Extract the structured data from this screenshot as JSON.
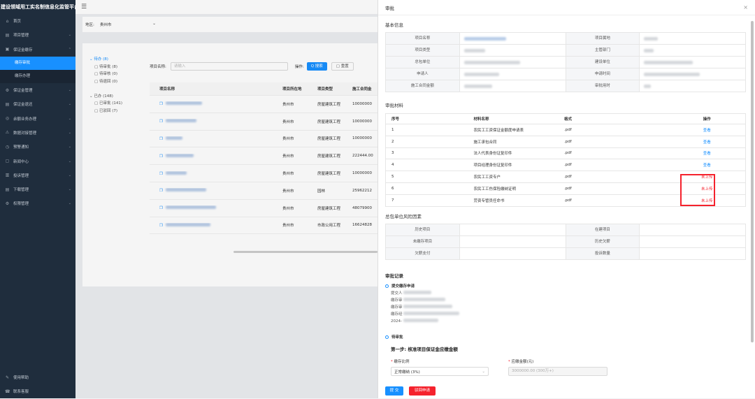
{
  "app": {
    "title": "建设领域用工实名制信息化监管平台"
  },
  "sidebar": {
    "items": [
      {
        "icon": "home-icon",
        "glyph": "⌂",
        "label": "首页",
        "chev": ""
      },
      {
        "icon": "project-icon",
        "glyph": "▤",
        "label": "项目管理",
        "chev": "⌄"
      },
      {
        "icon": "deposit-icon",
        "glyph": "▣",
        "label": "保证金缴存",
        "chev": "⌃"
      }
    ],
    "sub": [
      {
        "label": "缴存审批",
        "active": true
      },
      {
        "label": "缴存办理",
        "active": false
      }
    ],
    "items2": [
      {
        "icon": "manage-icon",
        "glyph": "⚙",
        "label": "保证金管理",
        "chev": "⌄"
      },
      {
        "icon": "return-icon",
        "glyph": "▤",
        "label": "保证金退还",
        "chev": "⌄"
      },
      {
        "icon": "dispute-icon",
        "glyph": "◎",
        "label": "余额业务办理",
        "chev": "⌄"
      },
      {
        "icon": "data-icon",
        "glyph": "⚠",
        "label": "数据对接管理",
        "chev": "⌄"
      },
      {
        "icon": "warning-icon",
        "glyph": "◷",
        "label": "预警通知",
        "chev": "⌄"
      },
      {
        "icon": "news-icon",
        "glyph": "▢",
        "label": "新闻中心",
        "chev": "⌄"
      },
      {
        "icon": "complaint-icon",
        "glyph": "▥",
        "label": "投诉管理",
        "chev": "⌄"
      },
      {
        "icon": "download-icon",
        "glyph": "▤",
        "label": "下载管理",
        "chev": "⌄"
      },
      {
        "icon": "auth-icon",
        "glyph": "⚙",
        "label": "权限管理",
        "chev": "⌄"
      }
    ],
    "bottom": [
      {
        "icon": "help-icon",
        "glyph": "✎",
        "label": "使用帮助"
      },
      {
        "icon": "service-icon",
        "glyph": "☎",
        "label": "联系客服"
      }
    ]
  },
  "topbar": {
    "menu_icon": "☰"
  },
  "region": {
    "label": "地区:",
    "value": "贵州市",
    "chev": "⌄"
  },
  "tree": [
    {
      "text": "⌄ 待办 (8)",
      "highlight": true
    },
    {
      "text": "▢ 待审批 (8)",
      "indent": true
    },
    {
      "text": "▢ 待审核 (0)",
      "indent": true
    },
    {
      "text": "▢ 待退回 (0)",
      "indent": true
    },
    {
      "text": "",
      "spacer": true
    },
    {
      "text": "⌄ 已办 (148)",
      "highlight": false
    },
    {
      "text": "▢ 已审批 (141)",
      "indent": true
    },
    {
      "text": "▢ 已驳回 (7)",
      "indent": true
    }
  ],
  "filter": {
    "name_label": "项目名称:",
    "name_placeholder": "请输入",
    "op_label": "操作:",
    "search": "Q 搜索",
    "reset": "▢ 重置"
  },
  "table": {
    "headers": [
      "项目名称",
      "项目所在地",
      "项目类型",
      "施工合同金"
    ],
    "rows": [
      {
        "loc": "贵州市",
        "type": "房屋建筑工程",
        "amount": "10000000"
      },
      {
        "loc": "贵州市",
        "type": "房屋建筑工程",
        "amount": "10000000"
      },
      {
        "loc": "贵州市",
        "type": "房屋建筑工程",
        "amount": "10000000"
      },
      {
        "loc": "贵州市",
        "type": "房屋建筑工程",
        "amount": "222444.00"
      },
      {
        "loc": "贵州市",
        "type": "房屋建筑工程",
        "amount": "10000000"
      },
      {
        "loc": "贵州市",
        "type": "园林",
        "amount": "25962212"
      },
      {
        "loc": "贵州市",
        "type": "房屋建筑工程",
        "amount": "48079900"
      },
      {
        "loc": "贵州市",
        "type": "市政公用工程",
        "amount": "16624828"
      }
    ]
  },
  "drawer": {
    "title": "审批",
    "close": "×",
    "basic_title": "基本信息",
    "basic": [
      [
        "项目名称",
        "项目属地"
      ],
      [
        "项目类型",
        "主管部门"
      ],
      [
        "总包单位",
        "建设单位"
      ],
      [
        "申请人",
        "申请时间"
      ],
      [
        "施工合同金额",
        "审批用时"
      ]
    ],
    "materials_title": "审批材料",
    "mat_headers": [
      "序号",
      "材料名称",
      "格式",
      "操作"
    ],
    "materials": [
      {
        "no": "1",
        "name": "农民工工资保证金额度申请表",
        "fmt": ".pdf",
        "op": "查看",
        "missing": false
      },
      {
        "no": "2",
        "name": "施工承包合同",
        "fmt": ".pdf",
        "op": "查看",
        "missing": false
      },
      {
        "no": "3",
        "name": "法人代表身份证复印件",
        "fmt": ".pdf",
        "op": "查看",
        "missing": false
      },
      {
        "no": "4",
        "name": "项目经理身份证复印件",
        "fmt": ".pdf",
        "op": "查看",
        "missing": false
      },
      {
        "no": "5",
        "name": "农民工工资专户",
        "fmt": ".pdf",
        "op": "未上传",
        "missing": true
      },
      {
        "no": "6",
        "name": "农民工工伤保险缴纳证明",
        "fmt": ".pdf",
        "op": "未上传",
        "missing": true
      },
      {
        "no": "7",
        "name": "劳资专管员任命书",
        "fmt": ".pdf",
        "op": "未上传",
        "missing": true
      }
    ],
    "risk_title": "总包单位风险因素",
    "risk": [
      [
        "历史项目",
        "在建项目"
      ],
      [
        "未缴存项目",
        "历史欠薪"
      ],
      [
        "欠薪支付",
        "投诉数量"
      ]
    ],
    "records_title": "审批记录",
    "record1_title": "提交缴存申请",
    "record1_lines": [
      "提交人",
      "缴存审",
      "缴存审",
      "缴存经",
      "2024-"
    ],
    "record2_title": "待审批",
    "step": "第一步: 核准项目保证金应缴金额",
    "ratio_label": "缴存比例",
    "ratio_value": "正常缴纳 (3%)",
    "amount_label": "应缴金额(元)",
    "amount_value": "3000000.00 (300万+)",
    "submit": "提 交",
    "reject": "驳回申请"
  },
  "colors": {
    "primary": "#1890ff",
    "danger": "#f5222d",
    "sidebar": "#1f2d3d"
  }
}
